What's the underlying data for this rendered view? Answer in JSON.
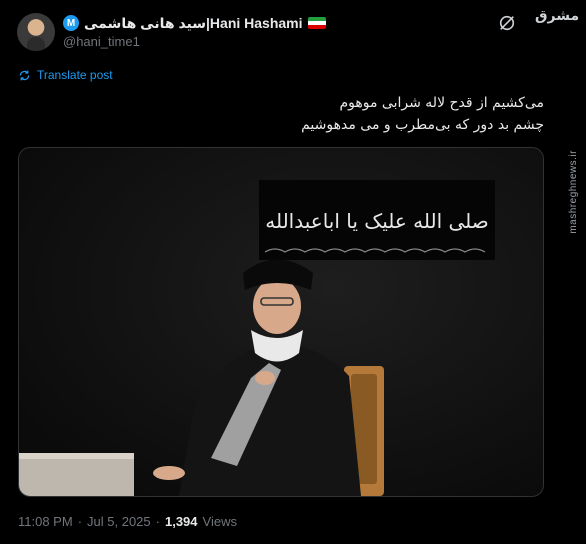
{
  "author": {
    "badge_letter": "M",
    "display_name": "سید هانی هاشمی|Hani Hashami",
    "handle": "@hani_time1"
  },
  "watermark": {
    "logo_text": "مشرق",
    "side_text": "mashreghnews.ir"
  },
  "translate": {
    "label": "Translate post"
  },
  "tweet": {
    "lines": [
      "می‌کشیم از قدح لاله شرابی موهوم",
      "چشم بد دور که بی‌مطرب و می مدهوشیم"
    ]
  },
  "photo": {
    "banner_text": "صلی الله علیک یا اباعبدالله"
  },
  "meta": {
    "time": "11:08 PM",
    "separator": "·",
    "date": "Jul 5, 2025",
    "views_count": "1,394",
    "views_label": "Views"
  },
  "colors": {
    "accent": "#1d9bf0",
    "text": "#e7e9ea",
    "muted": "#71767b",
    "background": "#000000"
  },
  "icons": [
    "avatar",
    "verified-badge",
    "iran-flag",
    "grok-icon",
    "translate-icon"
  ]
}
